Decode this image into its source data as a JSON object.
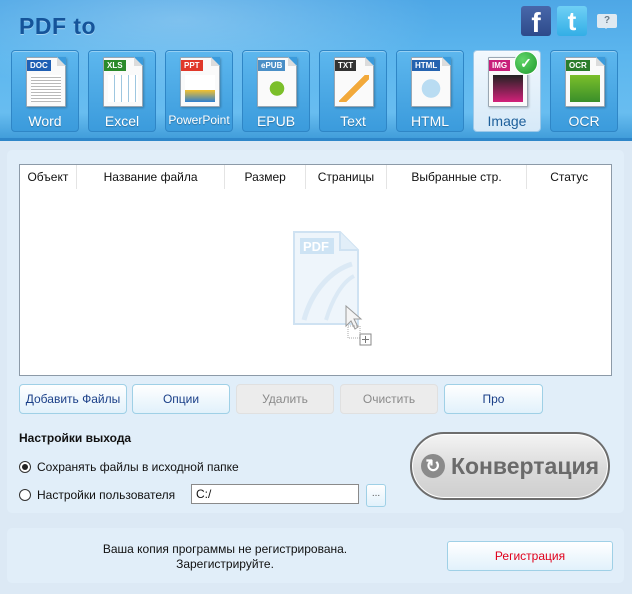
{
  "header": {
    "title": "PDF to",
    "social": {
      "facebook_icon": "f",
      "twitter_icon": "t",
      "help_icon": "?"
    }
  },
  "formats": [
    {
      "label": "Word",
      "tag": "DOC",
      "tag_color": "#1f5fb4",
      "active": false
    },
    {
      "label": "Excel",
      "tag": "XLS",
      "tag_color": "#2a8a2a",
      "active": false
    },
    {
      "label": "PowerPoint",
      "tag": "PPT",
      "tag_color": "#e0382a",
      "active": false
    },
    {
      "label": "EPUB",
      "tag": "ePUB",
      "tag_color": "#4a8fc7",
      "active": false
    },
    {
      "label": "Text",
      "tag": "TXT",
      "tag_color": "#333333",
      "active": false
    },
    {
      "label": "HTML",
      "tag": "HTML",
      "tag_color": "#2563b0",
      "active": false
    },
    {
      "label": "Image",
      "tag": "IMG",
      "tag_color": "#c81f7a",
      "active": true
    },
    {
      "label": "OCR",
      "tag": "OCR",
      "tag_color": "#2b7d2b",
      "active": false
    }
  ],
  "table": {
    "columns": [
      "Объект",
      "Название файла",
      "Размер",
      "Страницы",
      "Выбранные стр.",
      "Статус"
    ],
    "rows": [],
    "drop_hint_tag": "PDF"
  },
  "toolbar": {
    "add_files": "Добавить Файлы",
    "options": "Опции",
    "delete": "Удалить",
    "clear": "Очистить",
    "about": "Про"
  },
  "output": {
    "title": "Настройки выхода",
    "option_source": "Сохранять файлы в исходной папке",
    "option_custom": "Настройки пользователя",
    "selected": "source",
    "path_value": "C:/",
    "browse_label": "...",
    "convert_label": "Конвертация"
  },
  "registration": {
    "line1": "Ваша копия программы не регистрирована.",
    "line2": "Зарегистрируйте.",
    "button": "Регистрация",
    "button_color": "#e0001b"
  }
}
